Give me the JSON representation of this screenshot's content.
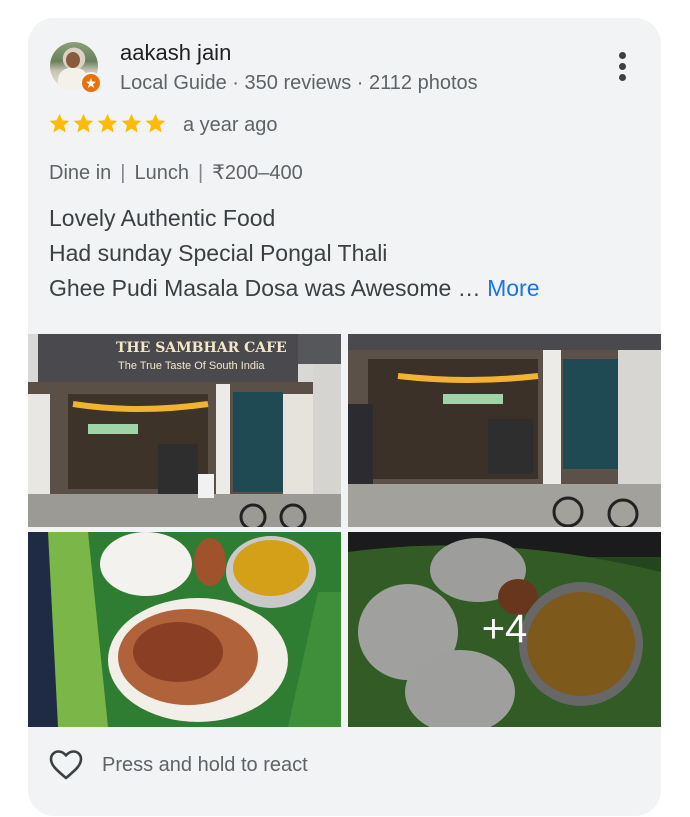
{
  "review": {
    "author_name": "aakash jain",
    "author_meta": "Local Guide · 350 reviews · 2112 photos",
    "rating": 5,
    "time_ago": "a year ago",
    "tags": [
      "Dine in",
      "Lunch",
      "₹200–400"
    ],
    "text_lines": [
      "Lovely Authentic Food",
      "Had sunday Special Pongal Thali",
      "Ghee Pudi Masala Dosa was Awesome …"
    ],
    "more_label": "More"
  },
  "photos": {
    "sign_title": "THE SAMBHAR CAFE",
    "sign_tagline": "The True Taste Of South India",
    "extra_count": "+4"
  },
  "actions": {
    "react_label": "Press and hold to react"
  },
  "colors": {
    "star": "#fbbc04",
    "link": "#1a73e8",
    "card_bg": "#f1f3f4",
    "badge": "#e8710a"
  }
}
